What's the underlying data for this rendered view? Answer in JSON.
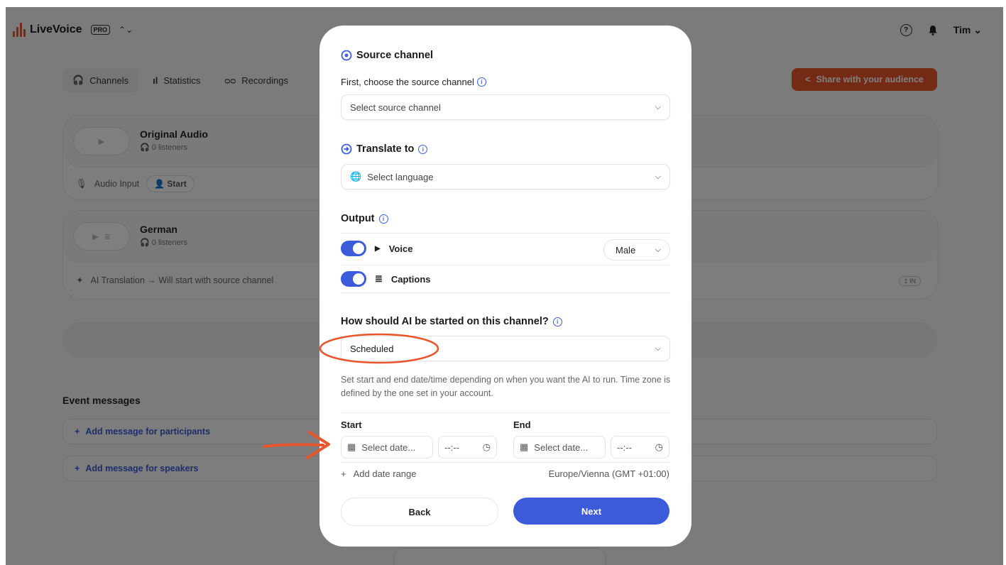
{
  "app": {
    "name": "LiveVoice",
    "plan_badge": "PRO",
    "switcher_glyph": "⌃⌄",
    "help_glyph": "?",
    "user": "Tim",
    "user_chevron": "⌄"
  },
  "tabs": [
    {
      "label": "Channels",
      "icon": "headphones-icon",
      "glyph": "🎧"
    },
    {
      "label": "Statistics",
      "icon": "stats-icon",
      "glyph": "ıl"
    },
    {
      "label": "Recordings",
      "icon": "recordings-icon",
      "glyph": "ᴑᴑ"
    }
  ],
  "share_button": {
    "label": "Share with your audience",
    "glyph": "<"
  },
  "channels": [
    {
      "title": "Original Audio",
      "listeners": "0 listeners",
      "footer_label": "Audio Input",
      "footer_action": "Start"
    },
    {
      "title": "German",
      "listeners": "0 listeners",
      "footer_label": "AI Translation → Will start with source channel",
      "badge": "1 IN"
    }
  ],
  "event_messages": {
    "title": "Event messages",
    "items": [
      "Add message for participants",
      "Add message for speakers"
    ]
  },
  "modal": {
    "source": {
      "title": "Source channel",
      "prompt": "First, choose the source channel",
      "placeholder": "Select source channel"
    },
    "translate": {
      "title": "Translate to",
      "placeholder": "Select language"
    },
    "output": {
      "title": "Output",
      "voice_label": "Voice",
      "voice_enabled": true,
      "voice_gender": "Male",
      "captions_label": "Captions",
      "captions_enabled": true
    },
    "start_mode": {
      "title": "How should AI be started on this channel?",
      "value": "Scheduled",
      "help_text": "Set start and end date/time depending on when you want the AI to run. Time zone is defined by the one set in your account."
    },
    "schedule": {
      "start_label": "Start",
      "end_label": "End",
      "date_placeholder": "Select date...",
      "time_placeholder": "--:--",
      "add_range": "Add date range",
      "timezone": "Europe/Vienna (GMT +01:00)"
    },
    "back_label": "Back",
    "next_label": "Next"
  },
  "colors": {
    "accent": "#3b5bdb",
    "brand": "#e8552a",
    "annotation": "#e8552a"
  }
}
